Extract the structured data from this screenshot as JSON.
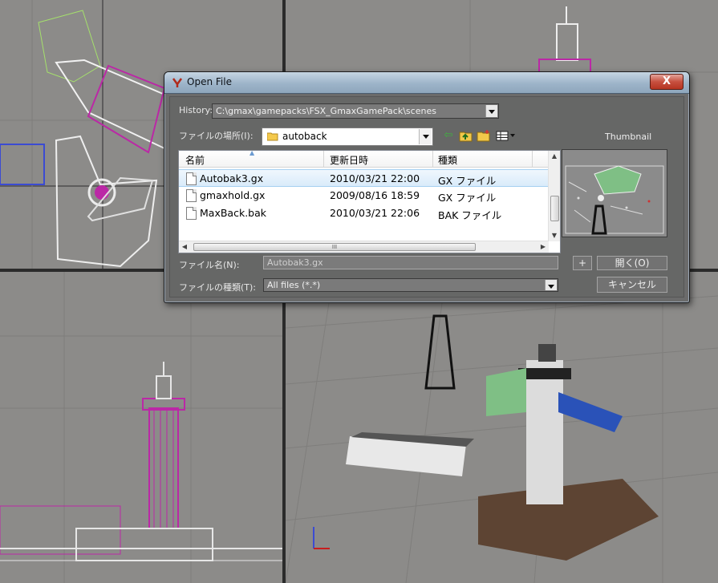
{
  "dialog": {
    "title": "Open File",
    "close_label": "X",
    "history_label": "History:",
    "history_value": "C:\\gmax\\gamepacks\\FSX_GmaxGamePack\\scenes",
    "lookin_label": "ファイルの場所(I):",
    "lookin_value": "autoback",
    "columns": {
      "name": "名前",
      "date": "更新日時",
      "type": "種類"
    },
    "files": [
      {
        "name": "Autobak3.gx",
        "date": "2010/03/21 22:00",
        "type": "GX ファイル"
      },
      {
        "name": "gmaxhold.gx",
        "date": "2009/08/16 18:59",
        "type": "GX ファイル"
      },
      {
        "name": "MaxBack.bak",
        "date": "2010/03/21 22:06",
        "type": "BAK ファイル"
      }
    ],
    "hscroll_grip": "III",
    "thumbnail_label": "Thumbnail",
    "filename_label": "ファイル名(N):",
    "filename_value": "Autobak3.gx",
    "filetype_label": "ファイルの種類(T):",
    "filetype_value": "All files (*.*)",
    "plus_label": "+",
    "open_label": "開く(O)",
    "cancel_label": "キャンセル"
  },
  "colors": {
    "viewport_bg": "#8c8b89",
    "selection_accent": "#a6d0f1",
    "title_gradient": "#9db4c9"
  },
  "icons": {
    "app": "gmax-icon",
    "folder": "folder-icon",
    "back": "back-arrow-icon",
    "up": "up-folder-icon",
    "new_folder": "new-folder-icon",
    "view": "view-menu-icon"
  }
}
